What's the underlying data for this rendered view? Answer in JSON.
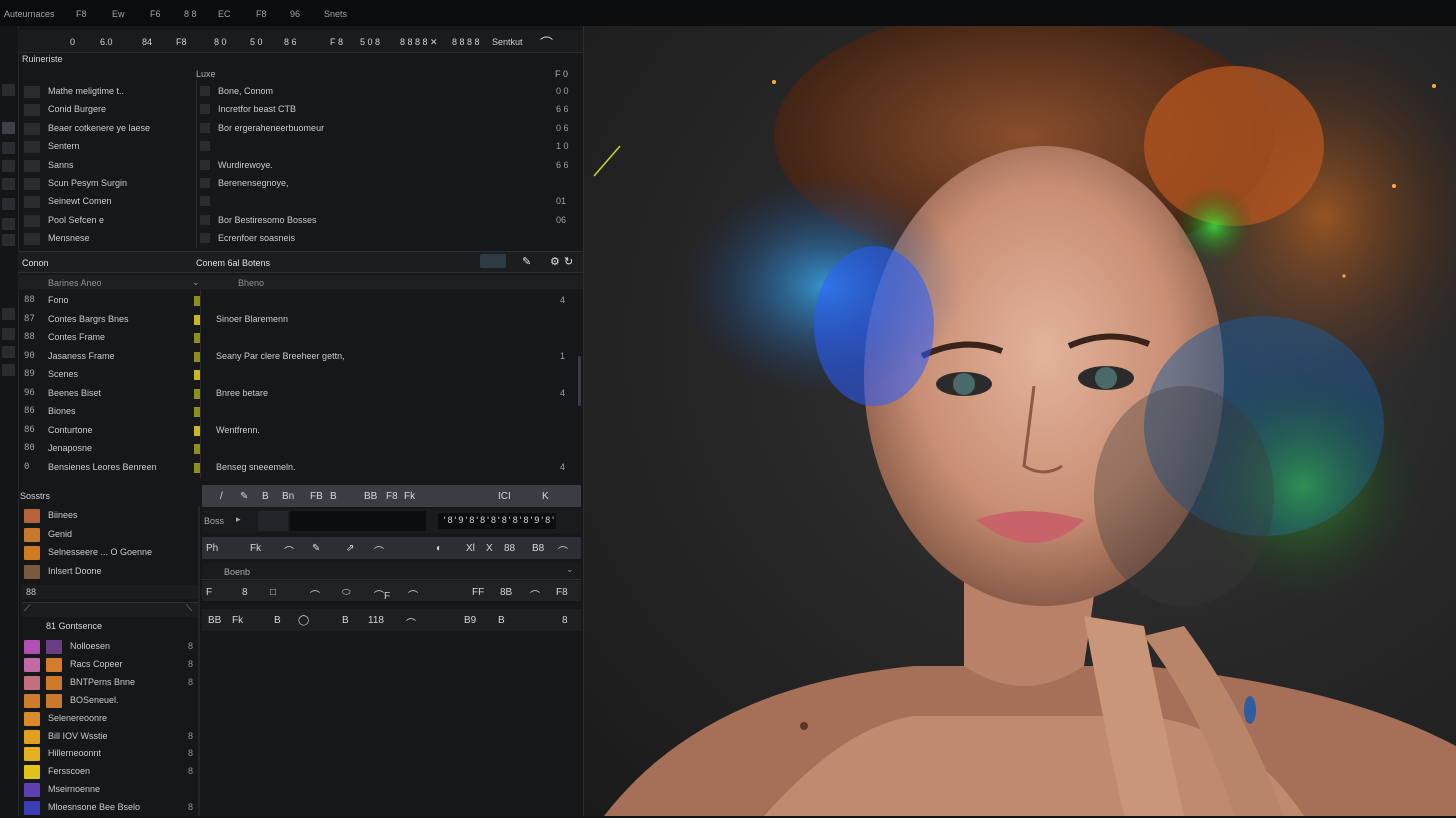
{
  "menubar": {
    "items": [
      "Auteurnaces",
      "F8",
      "Ew",
      "F6",
      "8 8",
      "EC",
      "F8",
      "96",
      "Snets"
    ]
  },
  "topbar": {
    "items": [
      "0",
      "6.0",
      "84",
      "F8",
      "8 0",
      "5 0",
      "8 6",
      "F 8",
      "5 0 8",
      "8 8 8 8 ✕",
      "8 8 8 8",
      "Sentkut"
    ]
  },
  "panel1": {
    "title": "Ruineriste",
    "col_header": "Luxe",
    "col_header_value": "F 0",
    "rows": [
      {
        "name": "Mathe meligtime t..",
        "desc": "Bone, Conom",
        "num": "0 0"
      },
      {
        "name": "Conid Burgere",
        "desc": "Incretfor beast CTB",
        "num": "6 6"
      },
      {
        "name": "Beaer cotkenere ye laese",
        "desc": "Bor ergeraheneerbuomeur",
        "num": "0 6"
      },
      {
        "name": "Sentern",
        "desc": "",
        "num": "1 0"
      },
      {
        "name": "Sanns",
        "desc": "Wurdirewoye.",
        "num": "6 6"
      },
      {
        "name": "Scun Pesym Surgin",
        "desc": "Berenensegnoye,",
        "num": ""
      },
      {
        "name": "Seinewt Comen",
        "desc": "",
        "num": "01"
      },
      {
        "name": "Pool Sefcen e",
        "desc": "Bor Bestiresomo Bosses",
        "num": "06"
      },
      {
        "name": "Mensnese",
        "desc": "Ecrenfoer soasneis",
        "num": ""
      }
    ]
  },
  "panel2": {
    "title": "Conon",
    "subtitle": "Conem 6al Botens",
    "col_header": "Barines Aneo",
    "col_header2": "Bheno",
    "rows": [
      {
        "icon": "88",
        "name": "Fono",
        "desc": "",
        "num": "4"
      },
      {
        "icon": "87",
        "name": "Contes Bargrs Bnes",
        "desc": "Sinoer Blaremenn",
        "num": ""
      },
      {
        "icon": "88",
        "name": "Contes Frame",
        "desc": "",
        "num": ""
      },
      {
        "icon": "90",
        "name": "Jasaness Frame",
        "desc": "Seany Par clere Breeheer gettn,",
        "num": "1"
      },
      {
        "icon": "89",
        "name": "Scenes",
        "desc": "",
        "num": ""
      },
      {
        "icon": "96",
        "name": "Beenes Biset",
        "desc": "Bnree betare",
        "num": "4"
      },
      {
        "icon": "86",
        "name": "Biones",
        "desc": "",
        "num": ""
      },
      {
        "icon": "86",
        "name": "Conturtone",
        "desc": "Wentfrenn.",
        "num": ""
      },
      {
        "icon": "80",
        "name": "Jenaposne",
        "desc": "",
        "num": ""
      },
      {
        "icon": "0",
        "name": "Bensienes Leores Benreen",
        "desc": "Benseg sneeemeln.",
        "num": "4"
      }
    ]
  },
  "panel3": {
    "title": "Sosstrs",
    "rows": [
      {
        "name": "Biinees",
        "color": "#b9633a"
      },
      {
        "name": "Genid",
        "color": "#c8782a"
      },
      {
        "name": "Selnesseere  ... O Goenne",
        "color": "#d07a22"
      },
      {
        "name": "Inlsert Doone",
        "color": "#7b5a40"
      }
    ],
    "subrow": "88",
    "group_title": "81 Gontsence",
    "swatches": [
      {
        "name": "Nolloesen",
        "color": "#b34fb3",
        "color2": "#6a3e84",
        "tail": "8"
      },
      {
        "name": "Racs Copeer",
        "color": "#c06aa8",
        "color2": "#d47c2c",
        "tail": "8"
      },
      {
        "name": "BNTPerns Bnne",
        "color": "#c27080",
        "color2": "#cc7a2a",
        "tail": "8"
      },
      {
        "name": "BOSeneuel.",
        "color": "#cf7a2c",
        "color2": "#c87a2a",
        "tail": ""
      },
      {
        "name": "Selenereoonre",
        "color": "#d98a2a",
        "color2": "",
        "tail": ""
      },
      {
        "name": "Bill IOV Wsstie",
        "color": "#e0a020",
        "color2": "",
        "tail": "8"
      },
      {
        "name": "Hillerneoonnt",
        "color": "#e6b020",
        "color2": "",
        "tail": "8"
      },
      {
        "name": "Fersscoen",
        "color": "#e2c318",
        "color2": "",
        "tail": "8"
      },
      {
        "name": "Mseirnoenne",
        "color": "#5c3fb0",
        "color2": "",
        "tail": ""
      },
      {
        "name": "Mloesnsone Bee Bselo",
        "color": "#3a3fb8",
        "color2": "",
        "tail": "8"
      }
    ]
  },
  "tools": {
    "row1": [
      "/",
      "✎",
      "B",
      "Bn",
      "FB",
      "B",
      "BB",
      "F8",
      "Fk"
    ],
    "row1_right": [
      "ICI",
      "K"
    ],
    "box_label": "Boss",
    "timeline_label": "'8'9'8'8'8'8'8'8'9'8'8",
    "row3": [
      "Ph",
      "Fk",
      "⌒",
      "✎",
      "⇗",
      "⌒",
      "◐",
      "Xl",
      "X",
      "88",
      "B8",
      "⌒"
    ],
    "row4_label": "Boenb",
    "row5": [
      "F",
      "8",
      "□",
      "⌒",
      "⬭",
      "⌒F",
      "⌒",
      "FF",
      "8B",
      "⌒",
      "F8"
    ],
    "row6": [
      "BB",
      "Fk",
      "B",
      "◯",
      "B",
      "118",
      "⌒",
      "B9",
      "B",
      "8"
    ]
  },
  "colors": {
    "accent_orange": "#d4722a",
    "accent_yellow": "#c8b81e",
    "bg": "#161718"
  }
}
